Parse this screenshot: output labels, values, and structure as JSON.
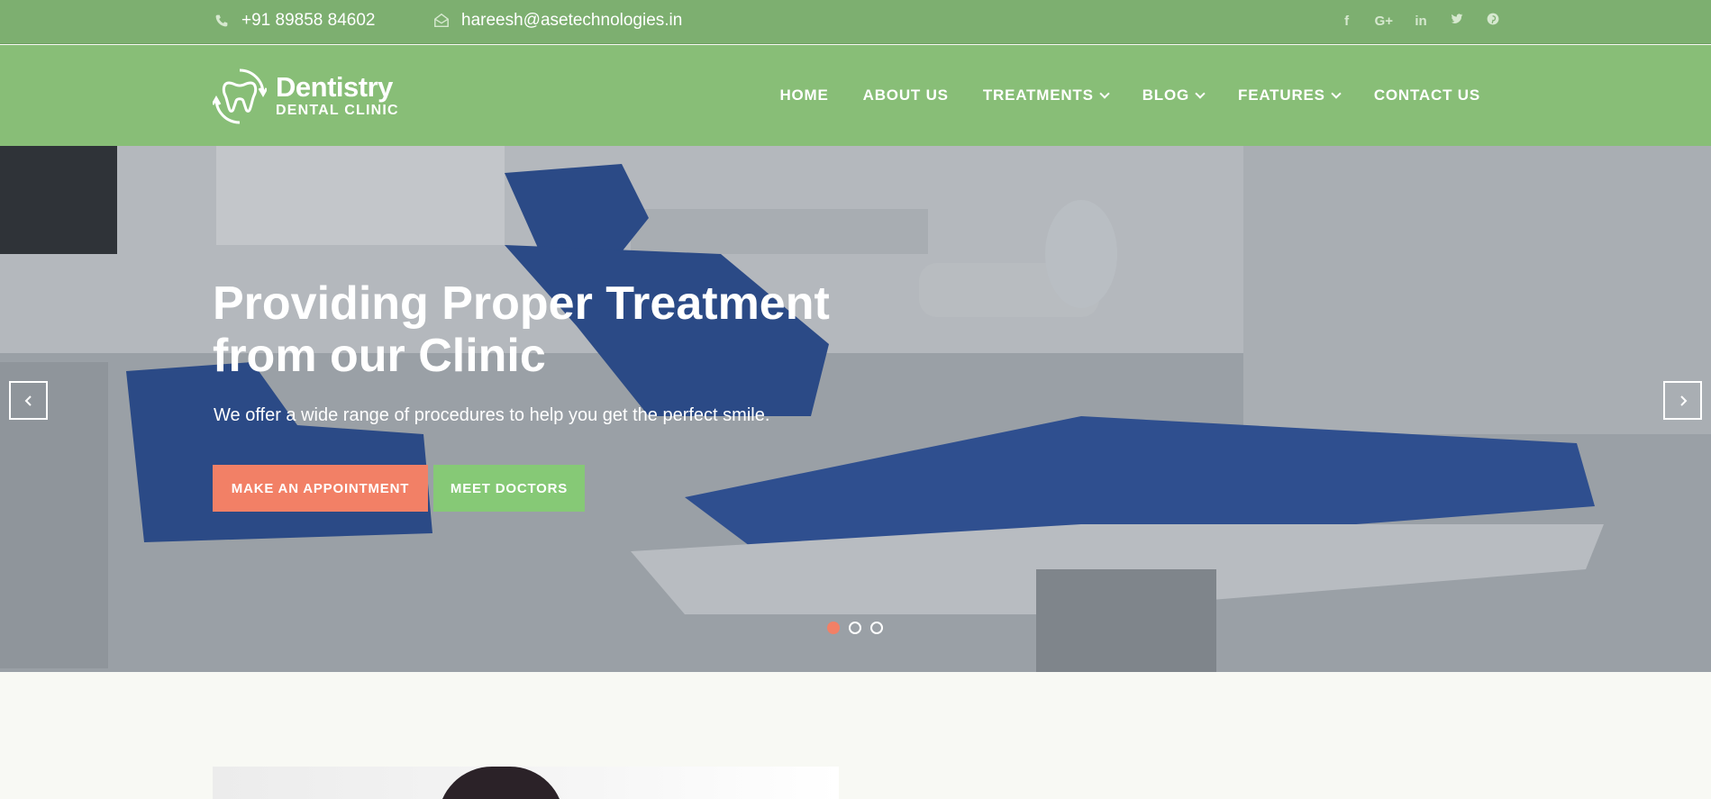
{
  "topbar": {
    "phone": "+91 89858 84602",
    "email": "hareesh@asetechnologies.in",
    "socials": [
      {
        "icon": "facebook-icon",
        "glyph": "f"
      },
      {
        "icon": "google-plus-icon",
        "glyph": "G+"
      },
      {
        "icon": "linkedin-icon",
        "glyph": "in"
      },
      {
        "icon": "twitter-icon",
        "glyph": "t"
      },
      {
        "icon": "pinterest-icon",
        "glyph": "p"
      }
    ]
  },
  "logo": {
    "name": "Dentistry",
    "sub": "DENTAL CLINIC"
  },
  "nav": {
    "items": [
      {
        "label": "HOME",
        "dropdown": false
      },
      {
        "label": "ABOUT US",
        "dropdown": false
      },
      {
        "label": "TREATMENTS",
        "dropdown": true
      },
      {
        "label": "BLOG",
        "dropdown": true
      },
      {
        "label": "FEATURES",
        "dropdown": true
      },
      {
        "label": "CONTACT US",
        "dropdown": false
      }
    ]
  },
  "hero": {
    "title": "Providing Proper Treatment from our Clinic",
    "subtitle": "We offer a wide range of procedures to help you get the perfect smile.",
    "primary_button": "MAKE AN APPOINTMENT",
    "secondary_button": "MEET DOCTORS",
    "slides": 3,
    "active_slide": 1
  },
  "colors": {
    "topbar": "#7daf70",
    "header": "#88be77",
    "accent": "#f28066",
    "green_button": "#86c976"
  }
}
